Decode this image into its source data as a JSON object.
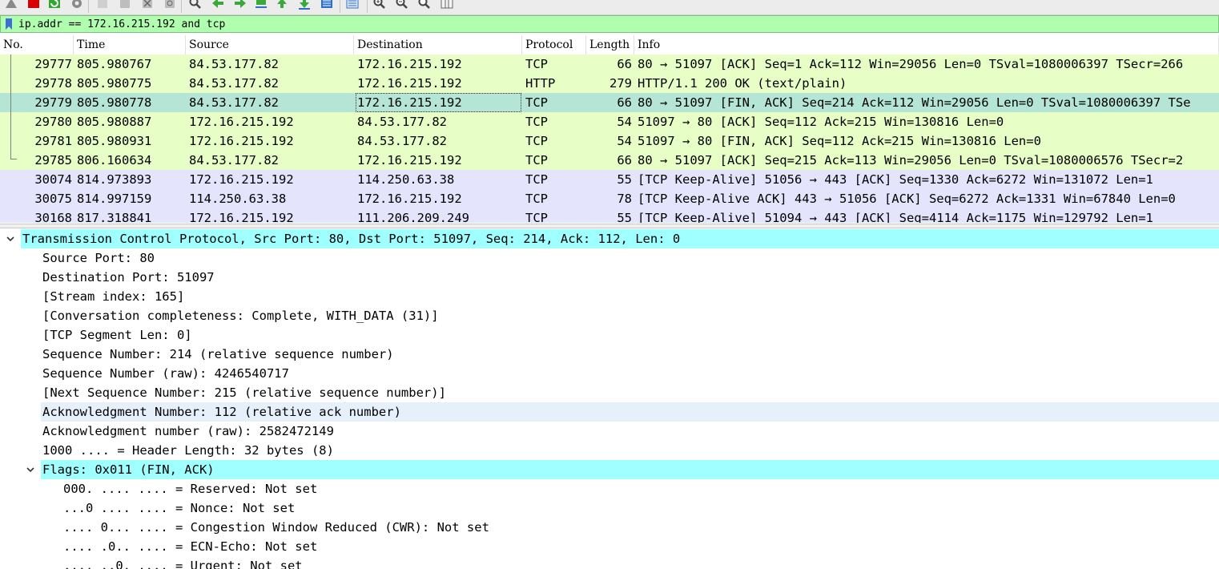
{
  "toolbar": {
    "icons": [
      "shark-fin-start-icon",
      "stop-capture-icon",
      "restart-capture-icon",
      "capture-options-icon",
      "open-file-icon",
      "save-file-icon",
      "close-file-icon",
      "reload-file-icon",
      "find-packet-icon",
      "go-back-icon",
      "go-forward-icon",
      "go-to-packet-icon",
      "go-first-packet-icon",
      "go-last-packet-icon",
      "auto-scroll-icon",
      "colorize-icon",
      "zoom-in-icon",
      "zoom-out-icon",
      "zoom-normal-icon",
      "resize-columns-icon"
    ]
  },
  "filter": {
    "value": "ip.addr == 172.16.215.192 and tcp"
  },
  "packet_list": {
    "columns": [
      "No.",
      "Time",
      "Source",
      "Destination",
      "Protocol",
      "Length",
      "Info"
    ],
    "rows": [
      {
        "no": "29777",
        "time": "805.980767",
        "src": "84.53.177.82",
        "dst": "172.16.215.192",
        "proto": "TCP",
        "len": "66",
        "info": "80 → 51097 [ACK] Seq=1 Ack=112 Win=29056 Len=0 TSval=1080006397 TSecr=266",
        "bg": "#e7ffc6"
      },
      {
        "no": "29778",
        "time": "805.980775",
        "src": "84.53.177.82",
        "dst": "172.16.215.192",
        "proto": "HTTP",
        "len": "279",
        "info": "HTTP/1.1 200 OK  (text/plain)",
        "bg": "#e7ffc6"
      },
      {
        "no": "29779",
        "time": "805.980778",
        "src": "84.53.177.82",
        "dst": "172.16.215.192",
        "proto": "TCP",
        "len": "66",
        "info": "80 → 51097 [FIN, ACK] Seq=214 Ack=112 Win=29056 Len=0 TSval=1080006397 TSe",
        "bg": "#b5e5d5",
        "selected": true
      },
      {
        "no": "29780",
        "time": "805.980887",
        "src": "172.16.215.192",
        "dst": "84.53.177.82",
        "proto": "TCP",
        "len": "54",
        "info": "51097 → 80 [ACK] Seq=112 Ack=215 Win=130816 Len=0",
        "bg": "#e7ffc6"
      },
      {
        "no": "29781",
        "time": "805.980931",
        "src": "172.16.215.192",
        "dst": "84.53.177.82",
        "proto": "TCP",
        "len": "54",
        "info": "51097 → 80 [FIN, ACK] Seq=112 Ack=215 Win=130816 Len=0",
        "bg": "#e7ffc6"
      },
      {
        "no": "29785",
        "time": "806.160634",
        "src": "84.53.177.82",
        "dst": "172.16.215.192",
        "proto": "TCP",
        "len": "66",
        "info": "80 → 51097 [ACK] Seq=215 Ack=113 Win=29056 Len=0 TSval=1080006576 TSecr=2",
        "bg": "#e7ffc6"
      },
      {
        "no": "30074",
        "time": "814.973893",
        "src": "172.16.215.192",
        "dst": "114.250.63.38",
        "proto": "TCP",
        "len": "55",
        "info": "[TCP Keep-Alive] 51056 → 443 [ACK] Seq=1330 Ack=6272 Win=131072 Len=1",
        "bg": "#e4e4fc"
      },
      {
        "no": "30075",
        "time": "814.997159",
        "src": "114.250.63.38",
        "dst": "172.16.215.192",
        "proto": "TCP",
        "len": "78",
        "info": "[TCP Keep-Alive ACK] 443 → 51056 [ACK] Seq=6272 Ack=1331 Win=67840 Len=0",
        "bg": "#e4e4fc"
      },
      {
        "no": "30168",
        "time": "817.318841",
        "src": "172.16.215.192",
        "dst": "111.206.209.249",
        "proto": "TCP",
        "len": "55",
        "info": "[TCP Keep-Alive] 51094 → 443 [ACK] Seq=4114 Ack=1175 Win=129792 Len=1",
        "bg": "#e4e4fc"
      }
    ]
  },
  "details": {
    "rows": [
      {
        "text": "Transmission Control Protocol, Src Port: 80, Dst Port: 51097, Seq: 214, Ack: 112, Len: 0",
        "level": 0,
        "expander": "expanded",
        "bg": "#a0ffff"
      },
      {
        "text": "Source Port: 80",
        "level": 1
      },
      {
        "text": "Destination Port: 51097",
        "level": 1
      },
      {
        "text": "[Stream index: 165]",
        "level": 1
      },
      {
        "text": "[Conversation completeness: Complete, WITH_DATA (31)]",
        "level": 1
      },
      {
        "text": "[TCP Segment Len: 0]",
        "level": 1
      },
      {
        "text": "Sequence Number: 214    (relative sequence number)",
        "level": 1
      },
      {
        "text": "Sequence Number (raw): 4246540717",
        "level": 1
      },
      {
        "text": "[Next Sequence Number: 215    (relative sequence number)]",
        "level": 1
      },
      {
        "text": "Acknowledgment Number: 112    (relative ack number)",
        "level": 1,
        "bg": "#e6f0fa"
      },
      {
        "text": "Acknowledgment number (raw): 2582472149",
        "level": 1
      },
      {
        "text": "1000 .... = Header Length: 32 bytes (8)",
        "level": 1
      },
      {
        "text": "Flags: 0x011 (FIN, ACK)",
        "level": 1,
        "expander": "expanded",
        "bg": "#a0ffff"
      },
      {
        "text": "000. .... .... = Reserved: Not set",
        "level": 2
      },
      {
        "text": "...0 .... .... = Nonce: Not set",
        "level": 2
      },
      {
        "text": ".... 0... .... = Congestion Window Reduced (CWR): Not set",
        "level": 2
      },
      {
        "text": ".... .0.. .... = ECN-Echo: Not set",
        "level": 2
      },
      {
        "text": ".... ..0. .... = Urgent: Not set",
        "level": 2
      }
    ]
  },
  "colors": {
    "filter_valid": "#afffaf",
    "tcp_row": "#e7ffc6",
    "selected_row": "#b5e5d5",
    "keepalive_row": "#e4e4fc",
    "tree_header": "#a0ffff"
  }
}
